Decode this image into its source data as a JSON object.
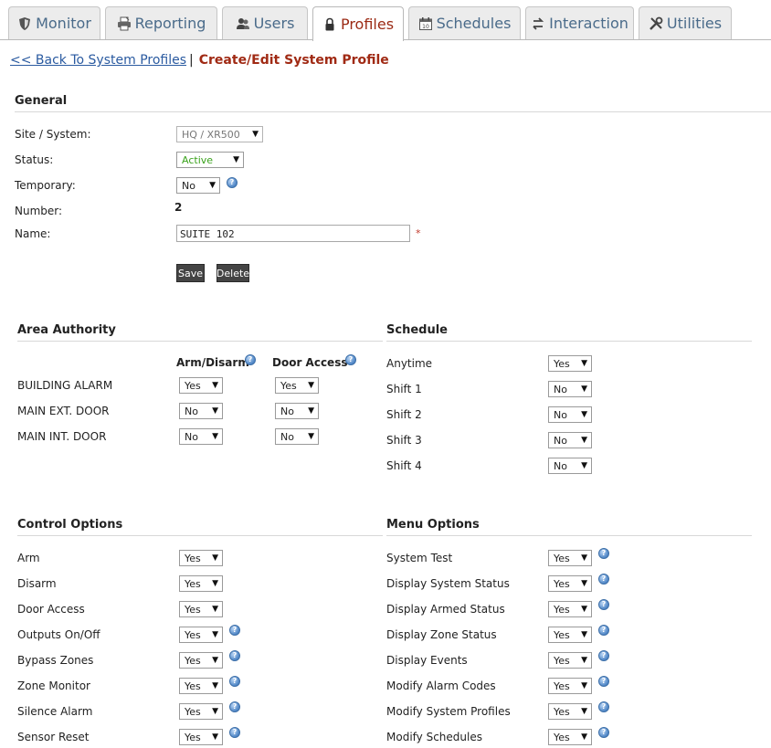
{
  "tabs": [
    {
      "label": "Monitor",
      "icon": "shield-icon"
    },
    {
      "label": "Reporting",
      "icon": "printer-icon"
    },
    {
      "label": "Users",
      "icon": "users-icon"
    },
    {
      "label": "Profiles",
      "icon": "lock-icon",
      "active": true
    },
    {
      "label": "Schedules",
      "icon": "calendar-icon"
    },
    {
      "label": "Interaction",
      "icon": "arrows-icon"
    },
    {
      "label": "Utilities",
      "icon": "tools-icon"
    }
  ],
  "breadcrumb": {
    "back": "<< Back To System Profiles",
    "separator": "|",
    "current": "Create/Edit System Profile"
  },
  "general": {
    "header": "General",
    "site_label": "Site / System:",
    "site_value": "HQ / XR500",
    "status_label": "Status:",
    "status_value": "Active",
    "temporary_label": "Temporary:",
    "temporary_value": "No",
    "number_label": "Number:",
    "number_value": "2",
    "name_label": "Name:",
    "name_value": "SUITE 102",
    "required_mark": "*",
    "save": "Save",
    "delete": "Delete"
  },
  "area_authority": {
    "header": "Area Authority",
    "col_arm": "Arm/Disarm",
    "col_door": "Door Access",
    "rows": [
      {
        "label": "BUILDING ALARM",
        "arm": "Yes",
        "door": "Yes"
      },
      {
        "label": "MAIN EXT. DOOR",
        "arm": "No",
        "door": "No"
      },
      {
        "label": "MAIN INT. DOOR",
        "arm": "No",
        "door": "No"
      }
    ]
  },
  "schedule": {
    "header": "Schedule",
    "rows": [
      {
        "label": "Anytime",
        "value": "Yes"
      },
      {
        "label": "Shift 1",
        "value": "No"
      },
      {
        "label": "Shift 2",
        "value": "No"
      },
      {
        "label": "Shift 3",
        "value": "No"
      },
      {
        "label": "Shift 4",
        "value": "No"
      }
    ]
  },
  "control_options": {
    "header": "Control Options",
    "rows": [
      {
        "label": "Arm",
        "value": "Yes",
        "help": false
      },
      {
        "label": "Disarm",
        "value": "Yes",
        "help": false
      },
      {
        "label": "Door Access",
        "value": "Yes",
        "help": false
      },
      {
        "label": "Outputs On/Off",
        "value": "Yes",
        "help": true
      },
      {
        "label": "Bypass Zones",
        "value": "Yes",
        "help": true
      },
      {
        "label": "Zone Monitor",
        "value": "Yes",
        "help": true
      },
      {
        "label": "Silence Alarm",
        "value": "Yes",
        "help": true
      },
      {
        "label": "Sensor Reset",
        "value": "Yes",
        "help": true
      }
    ]
  },
  "menu_options": {
    "header": "Menu Options",
    "rows": [
      {
        "label": "System Test",
        "value": "Yes"
      },
      {
        "label": "Display System Status",
        "value": "Yes"
      },
      {
        "label": "Display Armed Status",
        "value": "Yes"
      },
      {
        "label": "Display Zone Status",
        "value": "Yes"
      },
      {
        "label": "Display Events",
        "value": "Yes"
      },
      {
        "label": "Modify Alarm Codes",
        "value": "Yes"
      },
      {
        "label": "Modify System Profiles",
        "value": "Yes"
      },
      {
        "label": "Modify Schedules",
        "value": "Yes"
      }
    ]
  },
  "colors": {
    "active_tab": "#9b2a14",
    "tab_text": "#4a6b8a",
    "status_green": "#3aa21c",
    "link": "#2a5aa0"
  }
}
